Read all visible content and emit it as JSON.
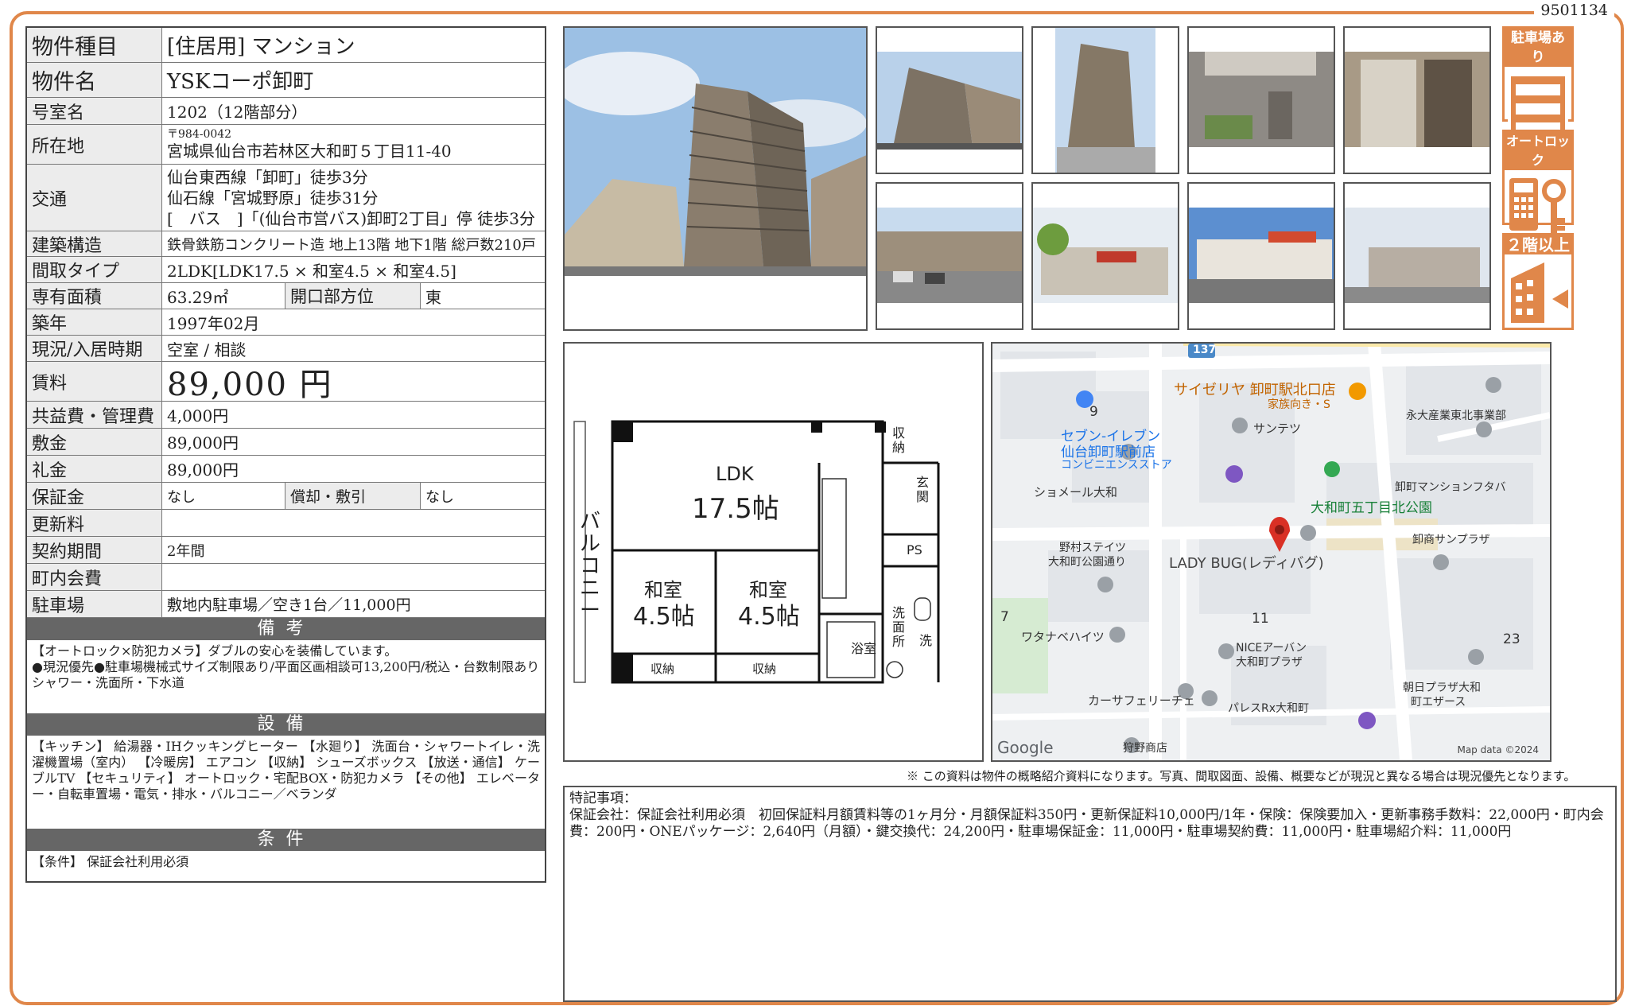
{
  "doc_code": "9501134",
  "spec": {
    "type_label": "物件種目",
    "type_value": "[住居用]  マンション",
    "name_label": "物件名",
    "name_value": "YSKコーポ卸町",
    "room_label": "号室名",
    "room_value": "1202（12階部分）",
    "address_label": "所在地",
    "address_zip": "〒984-0042",
    "address_value": "宮城県仙台市若林区大和町５丁目11-40",
    "transport_label": "交通",
    "transport_lines": [
      "仙台東西線「卸町」徒歩3分",
      "仙石線「宮城野原」徒歩31分",
      "[　バス　]「(仙台市営バス)卸町2丁目」停  徒歩3分"
    ],
    "structure_label": "建築構造",
    "structure_value": "鉄骨鉄筋コンクリート造  地上13階  地下1階  総戸数210戸",
    "layout_label": "間取タイプ",
    "layout_value": "2LDK[LDK17.5 × 和室4.5 × 和室4.5]",
    "area_label": "専有面積",
    "area_value": "63.29㎡",
    "direction_label": "開口部方位",
    "direction_value": "東",
    "built_label": "築年",
    "built_value": "1997年02月",
    "status_label": "現況/入居時期",
    "status_value": "空室 / 相談",
    "rent_label": "賃料",
    "rent_value": "89,000 円",
    "fee_label": "共益費・管理費",
    "fee_value": "4,000円",
    "deposit_label": "敷金",
    "deposit_value": "89,000円",
    "keymoney_label": "礼金",
    "keymoney_value": "89,000円",
    "guarantee_label": "保証金",
    "guarantee_value": "なし",
    "amort_label": "償却・敷引",
    "amort_value": "なし",
    "renewal_label": "更新料",
    "renewal_value": "",
    "contract_label": "契約期間",
    "contract_value": "2年間",
    "community_label": "町内会費",
    "community_value": "",
    "parking_label": "駐車場",
    "parking_value": "敷地内駐車場／空き1台／11,000円"
  },
  "remarks": {
    "title": "備考",
    "text": "【オートロック×防犯カメラ】ダブルの安心を装備しています。\n●現況優先●駐車場機械式サイズ制限あり/平面区画相談可13,200円/税込・台数制限あり\nシャワー・洗面所・下水道"
  },
  "equipment": {
    "title": "設備",
    "text": "【キッチン】 給湯器・IHクッキングヒーター 【水廻り】 洗面台・シャワートイレ・洗濯機置場（室内） 【冷暖房】 エアコン 【収納】 シューズボックス 【放送・通信】 ケーブルTV 【セキュリティ】 オートロック・宅配BOX・防犯カメラ 【その他】 エレベーター・自転車置場・電気・排水・バルコニー／ベランダ"
  },
  "conditions": {
    "title": "条件",
    "text": "【条件】 保証会社利用必須"
  },
  "badges": [
    "駐車場あり",
    "オートロック",
    "２階以上"
  ],
  "floorplan": {
    "balcony": "バルコニー",
    "ldk": "LDK",
    "ldk_size": "17.5帖",
    "washitsu": "和室",
    "washitsu_size": "4.5帖",
    "storage": "収納",
    "entrance": "玄関",
    "ps": "PS",
    "bath": "浴室",
    "washroom": "洗面所",
    "wash": "洗"
  },
  "map": {
    "route": "137",
    "labels": [
      "サイゼリヤ 卸町駅北口店",
      "家族向き・S",
      "セブン-イレブン",
      "仙台卸町駅前店",
      "コンビニエンスストア",
      "サンテツ",
      "永大産業東北事業部",
      "ショメール大和",
      "卸町マンションフタバ",
      "大和町五丁目北公園",
      "野村ステイツ",
      "大和町公園通り",
      "LADY BUG(レディバグ)",
      "卸商サンプラザ",
      "ワタナベハイツ",
      "NICEアーバン",
      "大和町プラザ",
      "カーサフェリーチェ",
      "パレスRx大和町",
      "朝日プラザ大和",
      "町エザース",
      "狩野商店"
    ],
    "numbers": [
      "9",
      "7",
      "11",
      "23"
    ],
    "google": "Google",
    "attribution": "Map data ©2024"
  },
  "disclaimer": "※ この資料は物件の概略紹介資料になります。写真、間取図面、設備、概要などが現況と異なる場合は現況優先となります。",
  "special_notes": {
    "title": "特記事項：",
    "text": "保証会社：保証会社利用必須　初回保証料月額賃料等の1ヶ月分・月額保証料350円・更新保証料10,000円/1年・保険：保険要加入・更新事務手数料：22,000円・町内会費：200円・ONEパッケージ：2,640円（月額）・鍵交換代：24,200円・駐車場保証金：11,000円・駐車場契約費：11,000円・駐車場紹介料：11,000円"
  },
  "colors": {
    "accent": "#e0874a",
    "header_gray": "#666666",
    "label_bg": "#ececec"
  }
}
